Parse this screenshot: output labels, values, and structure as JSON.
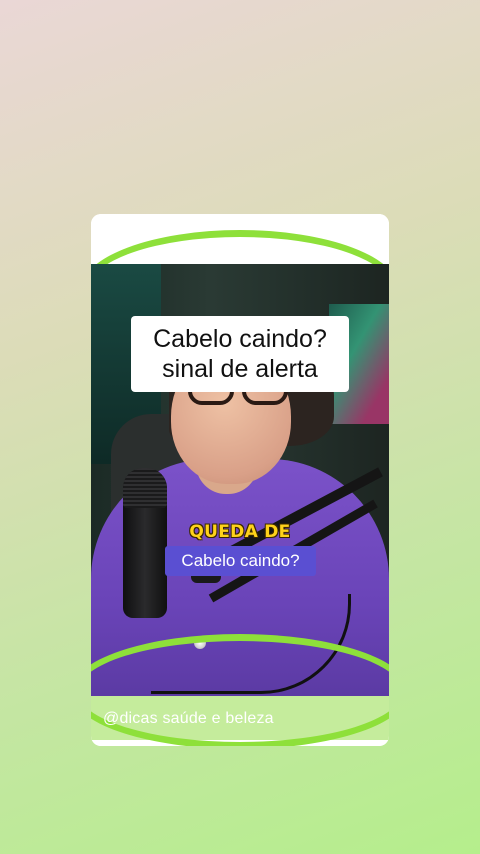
{
  "overlay": {
    "title_line1": "Cabelo caindo?",
    "title_line2": "sinal de alerta",
    "caption_highlight": "QUEDA DE",
    "caption_pill": "Cabelo caindo?",
    "handle": "@dicas saúde e beleza"
  },
  "colors": {
    "accent_green": "#8ee03a",
    "caption_yellow": "#ffd21a",
    "caption_pill_bg": "#5a4fd2",
    "blouse_purple": "#7b52c9"
  }
}
